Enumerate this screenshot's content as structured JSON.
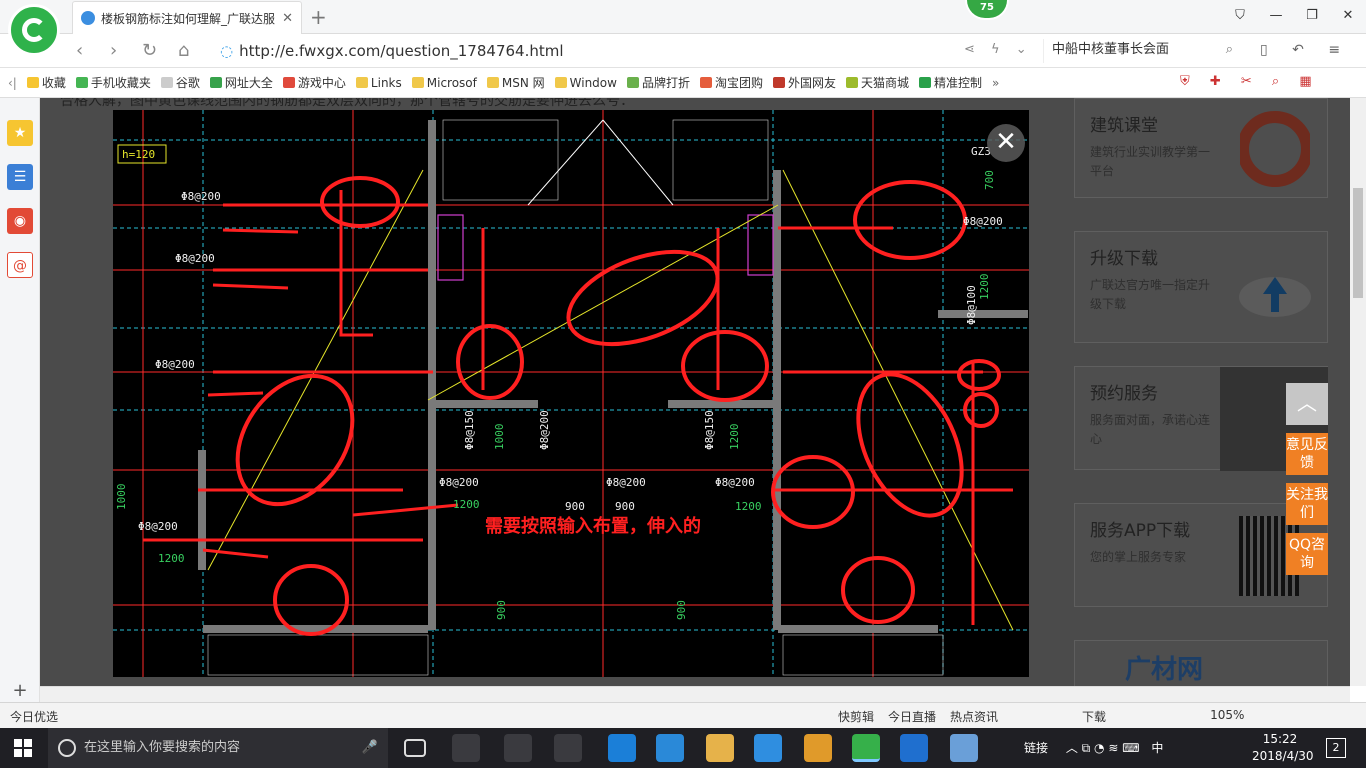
{
  "browser": {
    "tab_title": "楼板钢筋标注如何理解_广联达服",
    "badge": "75",
    "url": "http://e.fwxgx.com/question_1784764.html",
    "search_text": "中船中核董事长会面"
  },
  "bookmarks": [
    "收藏",
    "手机收藏夹",
    "谷歌",
    "网址大全",
    "游戏中心",
    "Links",
    "Microsof",
    "MSN 网",
    "Window",
    "品牌打折",
    "淘宝团购",
    "外国网友",
    "天猫商城",
    "精准控制"
  ],
  "page": {
    "top_text": "合格人解，图中黄色课线范围内的钢筋都是双层双向的，那个管辖号的交筋是要伸进去么号：",
    "cad": {
      "annotation": "需要按照输入布置，伸入的",
      "labels": [
        "h=120",
        "Φ8@200",
        "Φ8@200",
        "Φ8@200",
        "Φ8@200",
        "Φ8@150",
        "Φ8@200",
        "Φ8@200",
        "Φ8@150",
        "Φ8@200",
        "Φ8@200",
        "Φ8@200",
        "Φ8@100",
        "GZ3",
        "1200",
        "1200",
        "900",
        "900",
        "1200",
        "1200",
        "1000",
        "1000",
        "900",
        "900",
        "700",
        "1200"
      ]
    },
    "cards": [
      {
        "title": "建筑课堂",
        "desc": "建筑行业实训教学第一平台"
      },
      {
        "title": "升级下载",
        "desc": "广联达官方唯一指定升级下载"
      },
      {
        "title": "预约服务",
        "desc": "服务面对面，承诺心连心"
      },
      {
        "title": "服务APP下载",
        "desc": "您的掌上服务专家"
      },
      {
        "title": "广材网",
        "desc": ""
      }
    ],
    "float_buttons": [
      "意见反馈",
      "关注我们",
      "QQ咨询"
    ]
  },
  "statusbar": {
    "left": "今日优选",
    "items": [
      "快剪辑",
      "今日直播",
      "热点资讯",
      "下载",
      "105%"
    ]
  },
  "taskbar": {
    "search_placeholder": "在这里输入你要搜索的内容",
    "tray_text": "链接",
    "ime": "中",
    "time": "15:22",
    "date": "2018/4/30",
    "notifications": "2"
  }
}
